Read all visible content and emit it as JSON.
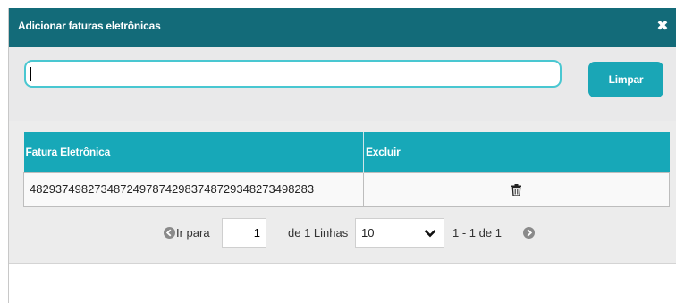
{
  "modal": {
    "title": "Adicionar faturas eletrônicas",
    "close_icon": "close-icon"
  },
  "search": {
    "value": "",
    "placeholder": "",
    "clear_label": "Limpar"
  },
  "grid": {
    "columns": [
      "Fatura Eletrônica",
      "Excluir"
    ],
    "rows": [
      {
        "fatura": "482937498273487249787429837487293482734982 83",
        "delete_icon": "trash-icon"
      }
    ]
  },
  "pager": {
    "goto_label": "Ir para",
    "page_value": "1",
    "of_label": "de 1 Linhas",
    "rows_per_page": "10",
    "range_label": "1 - 1  de  1",
    "prev_icon": "arrow-left-circle-icon",
    "next_icon": "arrow-right-circle-icon"
  },
  "colors": {
    "header": "#136b79",
    "accent": "#1aa6b6",
    "input_border": "#49c7d1"
  }
}
